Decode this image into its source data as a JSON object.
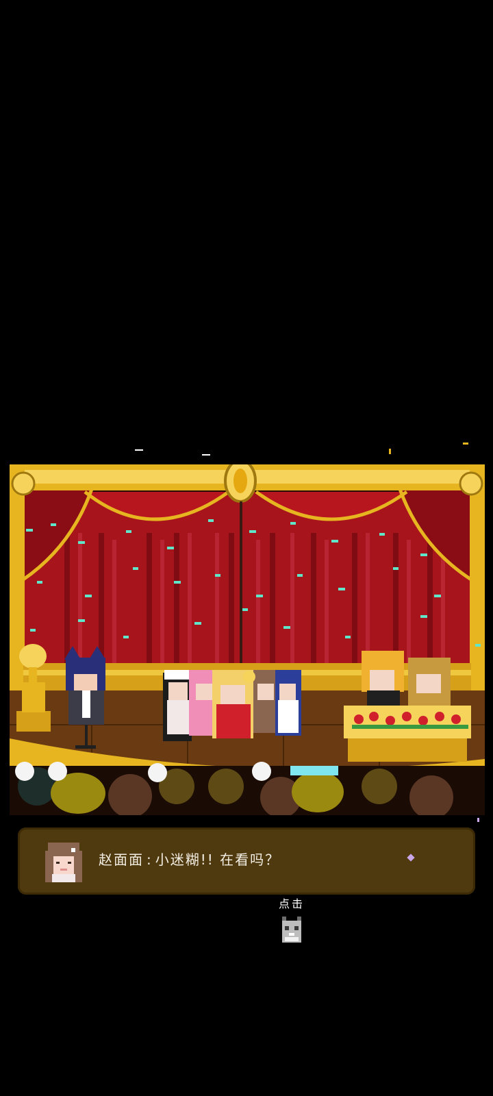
{
  "dialogue": {
    "speaker": "赵面面",
    "separator": ":",
    "line": "小迷糊!! 在看吗？"
  },
  "tap_hint": "点击",
  "icons": {
    "portrait": "brown-haired-girl-portrait-icon",
    "tap_indicator": "pixel-cat-icon"
  },
  "colors": {
    "background": "#000000",
    "curtain": "#a8141c",
    "gold_trim": "#e6b520",
    "dialogue_box": "#4f3a10",
    "confetti": "#5fe6c8"
  }
}
